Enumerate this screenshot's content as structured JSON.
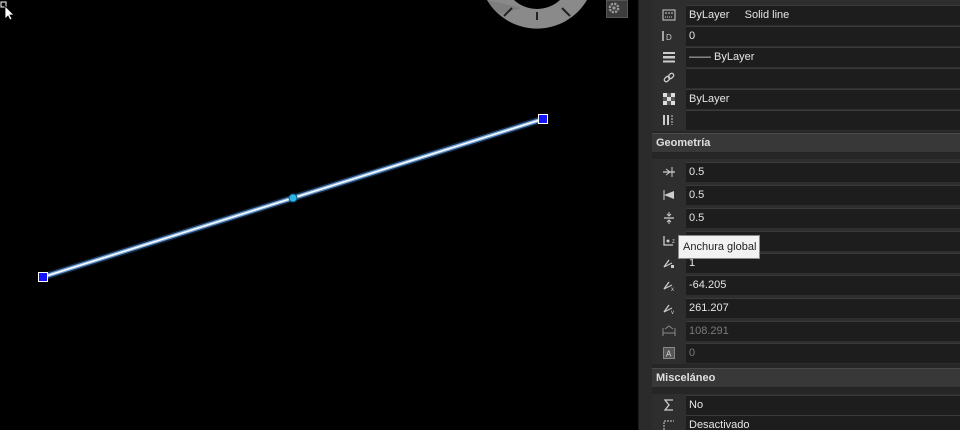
{
  "properties": {
    "general_rows": [
      {
        "icon": "linetype-icon",
        "value": "ByLayer     Solid line"
      },
      {
        "icon": "id-icon",
        "value": "0"
      },
      {
        "icon": "lineweight-icon",
        "value": "—— ByLayer"
      },
      {
        "icon": "hyperlink-icon",
        "value": ""
      },
      {
        "icon": "transparency-icon",
        "value": "ByLayer"
      },
      {
        "icon": "material-icon",
        "value": ""
      }
    ],
    "sections": {
      "geometry": "Geometría",
      "misc": "Misceláneo"
    },
    "geometry_rows": [
      {
        "icon": "start-segment-width-icon",
        "value": "0.5",
        "muted": false
      },
      {
        "icon": "end-segment-width-icon",
        "value": "0.5",
        "muted": false
      },
      {
        "icon": "global-width-icon",
        "value": "0.5",
        "muted": false
      },
      {
        "icon": "elevation-icon",
        "value": "",
        "muted": false
      },
      {
        "icon": "vertex-icon",
        "value": "1",
        "muted": false
      },
      {
        "icon": "vertex-x-icon",
        "value": "-64.205",
        "muted": false
      },
      {
        "icon": "vertex-y-icon",
        "value": "261.207",
        "muted": false
      },
      {
        "icon": "length-icon",
        "value": "108.291",
        "muted": true
      },
      {
        "icon": "area-icon",
        "value": "0",
        "muted": true
      }
    ],
    "misc_rows": [
      {
        "icon": "sum-icon",
        "value": "No"
      },
      {
        "icon": "linetype-generation-icon",
        "value": "Desactivado"
      }
    ]
  },
  "tooltip": "Anchura global",
  "colors": {
    "canvas_bg": "#000000",
    "panel_bg": "#2e2e2e",
    "line_glow": "#9fd4ff",
    "grip": "#1414ff",
    "midpoint": "#2fb6e6"
  }
}
